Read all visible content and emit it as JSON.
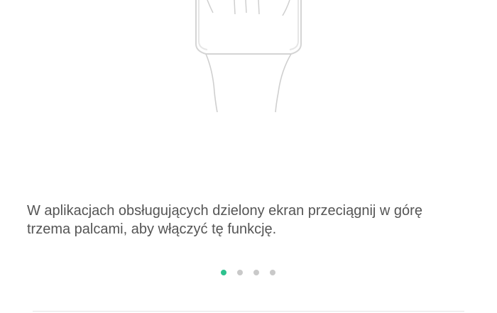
{
  "guide": {
    "description": "W aplikacjach obsługujących dzielony ekran przeciągnij w górę trzema palcami, aby włączyć tę funkcję."
  },
  "pager": {
    "page_count": 4,
    "active_page": 1,
    "active_color": "#2ec28e",
    "inactive_color": "#c9c9c9"
  },
  "illustration": {
    "icon": "hand-swipe-up-icon"
  }
}
